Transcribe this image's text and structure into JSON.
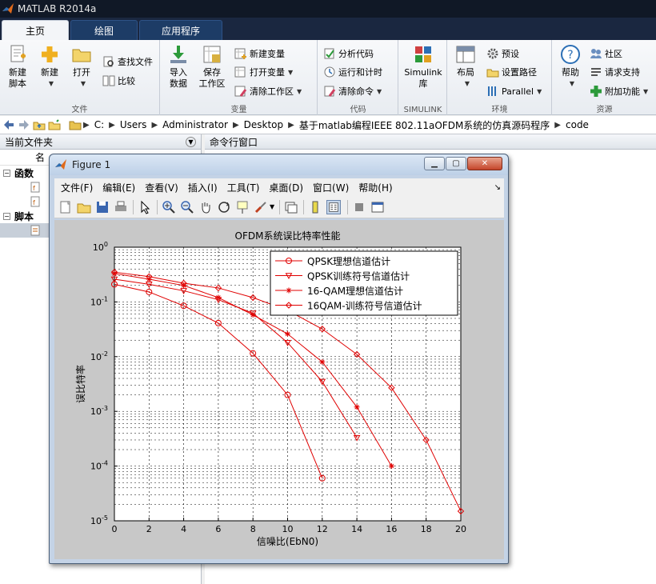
{
  "app": {
    "title": "MATLAB R2014a"
  },
  "tabs": [
    {
      "label": "主页",
      "active": true
    },
    {
      "label": "绘图",
      "active": false
    },
    {
      "label": "应用程序",
      "active": false
    }
  ],
  "ribbon": {
    "file": {
      "group_label": "文件",
      "new_script": "新建\n脚本",
      "new": "新建",
      "open": "打开",
      "find_files": "查找文件",
      "compare": "比较"
    },
    "variable": {
      "group_label": "变量",
      "import_data": "导入\n数据",
      "save_workspace": "保存\n工作区",
      "new_variable": "新建变量",
      "open_variable": "打开变量",
      "clear_workspace": "清除工作区"
    },
    "code": {
      "group_label": "代码",
      "analyze_code": "分析代码",
      "run_and_time": "运行和计时",
      "clear_commands": "清除命令"
    },
    "simulink": {
      "group_label": "SIMULINK",
      "library": "Simulink\n库"
    },
    "environment": {
      "group_label": "环境",
      "layout": "布局",
      "preferences": "预设",
      "set_path": "设置路径",
      "parallel": "Parallel"
    },
    "resources": {
      "group_label": "资源",
      "help": "帮助",
      "community": "社区",
      "request_support": "请求支持",
      "addons": "附加功能"
    }
  },
  "address": {
    "crumbs": [
      "C:",
      "Users",
      "Administrator",
      "Desktop",
      "基于matlab编程IEEE 802.11aOFDM系统的仿真源码程序",
      "code"
    ]
  },
  "left_panel": {
    "header": "当前文件夹",
    "column_name": "名",
    "sections": [
      "函数",
      "脚本"
    ]
  },
  "command_panel": {
    "header": "命令行窗口"
  },
  "figure": {
    "title": "Figure 1",
    "menu": [
      "文件(F)",
      "编辑(E)",
      "查看(V)",
      "插入(I)",
      "工具(T)",
      "桌面(D)",
      "窗口(W)",
      "帮助(H)"
    ]
  },
  "colors": {
    "series": "#e00000",
    "titlebar": "#101826",
    "tab_active": "#f3f5f8"
  },
  "chart_data": {
    "type": "line",
    "title": "OFDM系统误比特率性能",
    "xlabel": "信噪比(EbN0)",
    "ylabel": "误比特率",
    "xlim": [
      0,
      20
    ],
    "ylim": [
      1e-05,
      1
    ],
    "yscale": "log",
    "xticks": [
      0,
      2,
      4,
      6,
      8,
      10,
      12,
      14,
      16,
      18,
      20
    ],
    "yticks": [
      {
        "value": 1,
        "label": "10",
        "exp": "0"
      },
      {
        "value": 0.1,
        "label": "10",
        "exp": "-1"
      },
      {
        "value": 0.01,
        "label": "10",
        "exp": "-2"
      },
      {
        "value": 0.001,
        "label": "10",
        "exp": "-3"
      },
      {
        "value": 0.0001,
        "label": "10",
        "exp": "-4"
      },
      {
        "value": 1e-05,
        "label": "10",
        "exp": "-5"
      }
    ],
    "grid": true,
    "legend_position": "top-right",
    "series": [
      {
        "name": "QPSK理想信道估计",
        "marker": "circle",
        "x": [
          0,
          2,
          4,
          6,
          8,
          10,
          12
        ],
        "y": [
          0.21,
          0.152,
          0.085,
          0.041,
          0.0115,
          0.002,
          6e-05
        ]
      },
      {
        "name": "QPSK训练符号信道估计",
        "marker": "triangle-down",
        "x": [
          0,
          2,
          4,
          6,
          8,
          10,
          12,
          14
        ],
        "y": [
          0.26,
          0.21,
          0.16,
          0.11,
          0.062,
          0.018,
          0.0035,
          0.00033
        ]
      },
      {
        "name": "16-QAM理想信道估计",
        "marker": "star",
        "x": [
          0,
          2,
          4,
          6,
          8,
          10,
          12,
          14,
          16
        ],
        "y": [
          0.33,
          0.26,
          0.2,
          0.12,
          0.058,
          0.026,
          0.008,
          0.0012,
          0.0001
        ]
      },
      {
        "name": "16QAM-训练符号信道估计",
        "marker": "diamond",
        "x": [
          0,
          2,
          4,
          6,
          8,
          10,
          12,
          14,
          16,
          18,
          20
        ],
        "y": [
          0.35,
          0.29,
          0.22,
          0.18,
          0.12,
          0.07,
          0.032,
          0.011,
          0.0027,
          0.0003,
          1.5e-05
        ]
      }
    ]
  }
}
